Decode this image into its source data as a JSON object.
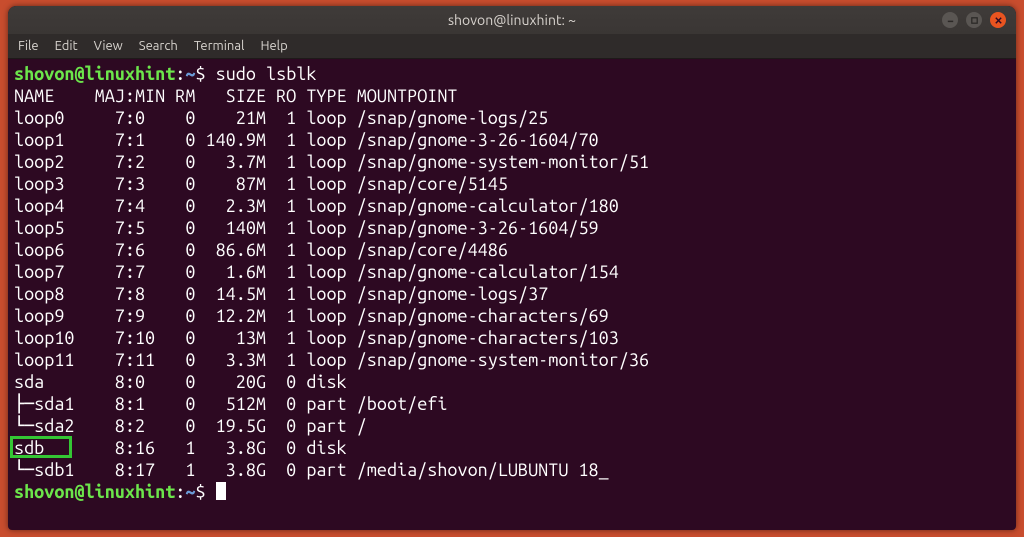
{
  "window": {
    "title": "shovon@linuxhint: ~"
  },
  "menu": {
    "items": [
      "File",
      "Edit",
      "View",
      "Search",
      "Terminal",
      "Help"
    ]
  },
  "prompt": {
    "userhost": "shovon@linuxhint",
    "path": "~"
  },
  "command": "sudo lsblk",
  "table": {
    "header": "NAME    MAJ:MIN RM   SIZE RO TYPE MOUNTPOINT",
    "rows": [
      "loop0     7:0    0    21M  1 loop /snap/gnome-logs/25",
      "loop1     7:1    0 140.9M  1 loop /snap/gnome-3-26-1604/70",
      "loop2     7:2    0   3.7M  1 loop /snap/gnome-system-monitor/51",
      "loop3     7:3    0    87M  1 loop /snap/core/5145",
      "loop4     7:4    0   2.3M  1 loop /snap/gnome-calculator/180",
      "loop5     7:5    0   140M  1 loop /snap/gnome-3-26-1604/59",
      "loop6     7:6    0  86.6M  1 loop /snap/core/4486",
      "loop7     7:7    0   1.6M  1 loop /snap/gnome-calculator/154",
      "loop8     7:8    0  14.5M  1 loop /snap/gnome-logs/37",
      "loop9     7:9    0  12.2M  1 loop /snap/gnome-characters/69",
      "loop10    7:10   0    13M  1 loop /snap/gnome-characters/103",
      "loop11    7:11   0   3.3M  1 loop /snap/gnome-system-monitor/36",
      "sda       8:0    0    20G  0 disk ",
      "├─sda1    8:1    0   512M  0 part /boot/efi",
      "└─sda2    8:2    0  19.5G  0 part /",
      "sdb       8:16   1   3.8G  0 disk ",
      "└─sdb1    8:17   1   3.8G  0 part /media/shovon/LUBUNTU 18_"
    ]
  },
  "highlight": {
    "row_index": 15
  },
  "chart_data": {
    "type": "table",
    "columns": [
      "NAME",
      "MAJ:MIN",
      "RM",
      "SIZE",
      "RO",
      "TYPE",
      "MOUNTPOINT"
    ],
    "rows": [
      [
        "loop0",
        "7:0",
        "0",
        "21M",
        "1",
        "loop",
        "/snap/gnome-logs/25"
      ],
      [
        "loop1",
        "7:1",
        "0",
        "140.9M",
        "1",
        "loop",
        "/snap/gnome-3-26-1604/70"
      ],
      [
        "loop2",
        "7:2",
        "0",
        "3.7M",
        "1",
        "loop",
        "/snap/gnome-system-monitor/51"
      ],
      [
        "loop3",
        "7:3",
        "0",
        "87M",
        "1",
        "loop",
        "/snap/core/5145"
      ],
      [
        "loop4",
        "7:4",
        "0",
        "2.3M",
        "1",
        "loop",
        "/snap/gnome-calculator/180"
      ],
      [
        "loop5",
        "7:5",
        "0",
        "140M",
        "1",
        "loop",
        "/snap/gnome-3-26-1604/59"
      ],
      [
        "loop6",
        "7:6",
        "0",
        "86.6M",
        "1",
        "loop",
        "/snap/core/4486"
      ],
      [
        "loop7",
        "7:7",
        "0",
        "1.6M",
        "1",
        "loop",
        "/snap/gnome-calculator/154"
      ],
      [
        "loop8",
        "7:8",
        "0",
        "14.5M",
        "1",
        "loop",
        "/snap/gnome-logs/37"
      ],
      [
        "loop9",
        "7:9",
        "0",
        "12.2M",
        "1",
        "loop",
        "/snap/gnome-characters/69"
      ],
      [
        "loop10",
        "7:10",
        "0",
        "13M",
        "1",
        "loop",
        "/snap/gnome-characters/103"
      ],
      [
        "loop11",
        "7:11",
        "0",
        "3.3M",
        "1",
        "loop",
        "/snap/gnome-system-monitor/36"
      ],
      [
        "sda",
        "8:0",
        "0",
        "20G",
        "0",
        "disk",
        ""
      ],
      [
        "sda1",
        "8:1",
        "0",
        "512M",
        "0",
        "part",
        "/boot/efi"
      ],
      [
        "sda2",
        "8:2",
        "0",
        "19.5G",
        "0",
        "part",
        "/"
      ],
      [
        "sdb",
        "8:16",
        "1",
        "3.8G",
        "0",
        "disk",
        ""
      ],
      [
        "sdb1",
        "8:17",
        "1",
        "3.8G",
        "0",
        "part",
        "/media/shovon/LUBUNTU 18_"
      ]
    ]
  }
}
